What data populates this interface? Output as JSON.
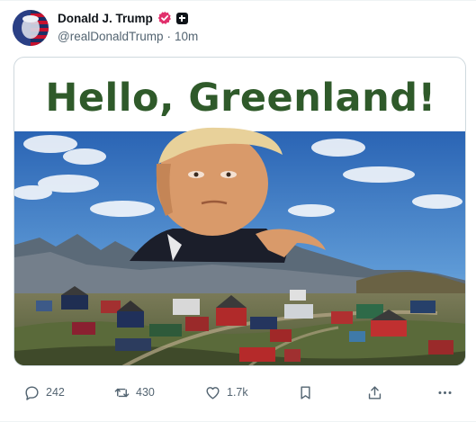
{
  "post": {
    "author": {
      "display_name": "Donald J. Trump",
      "handle": "@realDonaldTrump",
      "separator": "·",
      "timestamp": "10m",
      "verified_badge_color": "#e1306c"
    },
    "media": {
      "headline": "Hello, Greenland!",
      "headline_color": "#2f5a2a"
    },
    "actions": {
      "reply_count": "242",
      "repost_count": "430",
      "like_count": "1.7k"
    }
  },
  "icons": [
    "reply-icon",
    "repost-icon",
    "like-icon",
    "bookmark-icon",
    "share-icon",
    "more-icon",
    "verified-badge-icon",
    "affiliate-badge-icon"
  ]
}
